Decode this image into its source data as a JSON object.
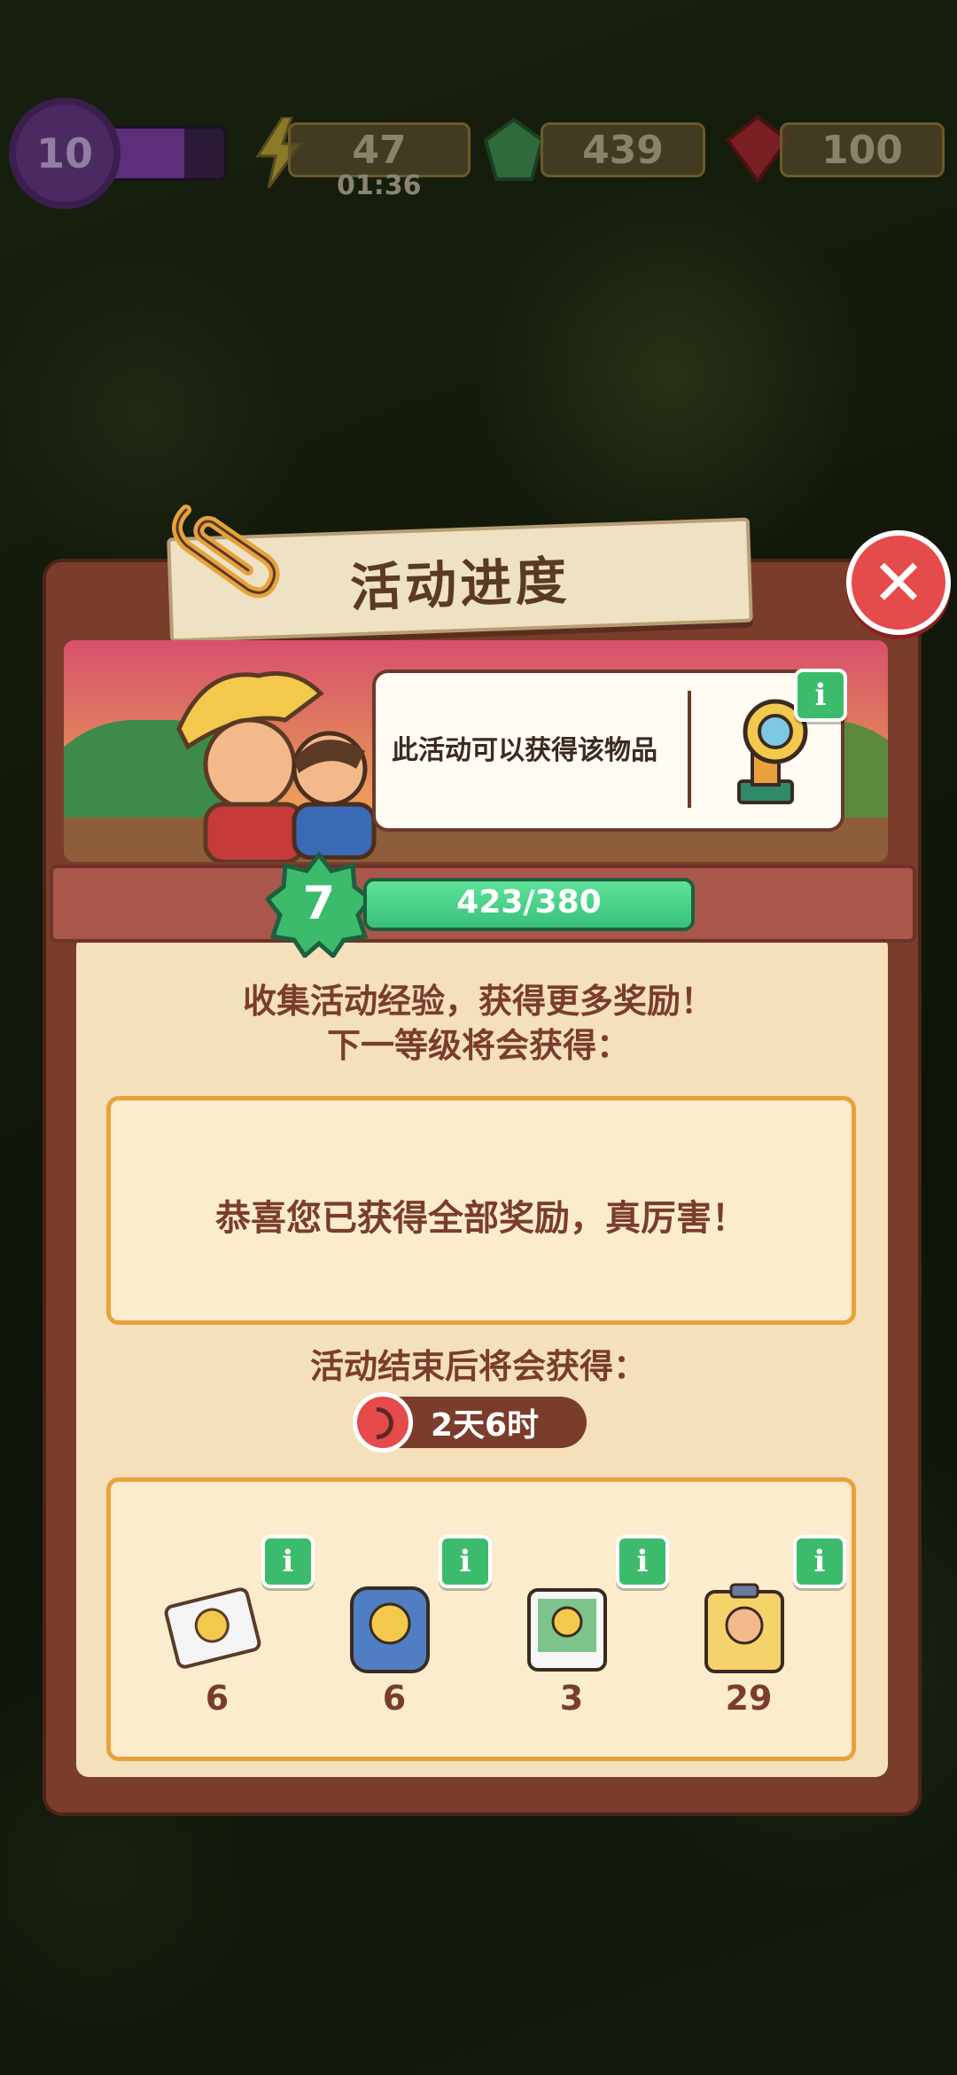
{
  "hud": {
    "level": "10",
    "energy": "47",
    "energy_timer": "01:36",
    "gems": "439",
    "rubies": "100"
  },
  "panel": {
    "title": "活动进度",
    "close_icon": "close-icon",
    "bubble_text": "此活动可以获得该物品",
    "level": "7",
    "progress_text": "423/380",
    "progress_fraction": 1.0,
    "line1": "收集活动经验，获得更多奖励！",
    "line2": "下一等级将会获得：",
    "congrats": "恭喜您已获得全部奖励，真厉害！",
    "end_label": "活动结束后将会获得：",
    "time_left": "2天6时",
    "rewards": [
      {
        "icon": "photo-card-icon",
        "count": "6"
      },
      {
        "icon": "blue-bottle-card-icon",
        "count": "6"
      },
      {
        "icon": "green-photo-card-icon",
        "count": "3"
      },
      {
        "icon": "yellow-card-icon",
        "count": "29"
      }
    ]
  },
  "colors": {
    "panel": "#7a3d2c",
    "panel_inner": "#f4e0bb",
    "accent_orange": "#e8a23c",
    "progress_green": "#38c07a",
    "close_red": "#e64b4b"
  }
}
